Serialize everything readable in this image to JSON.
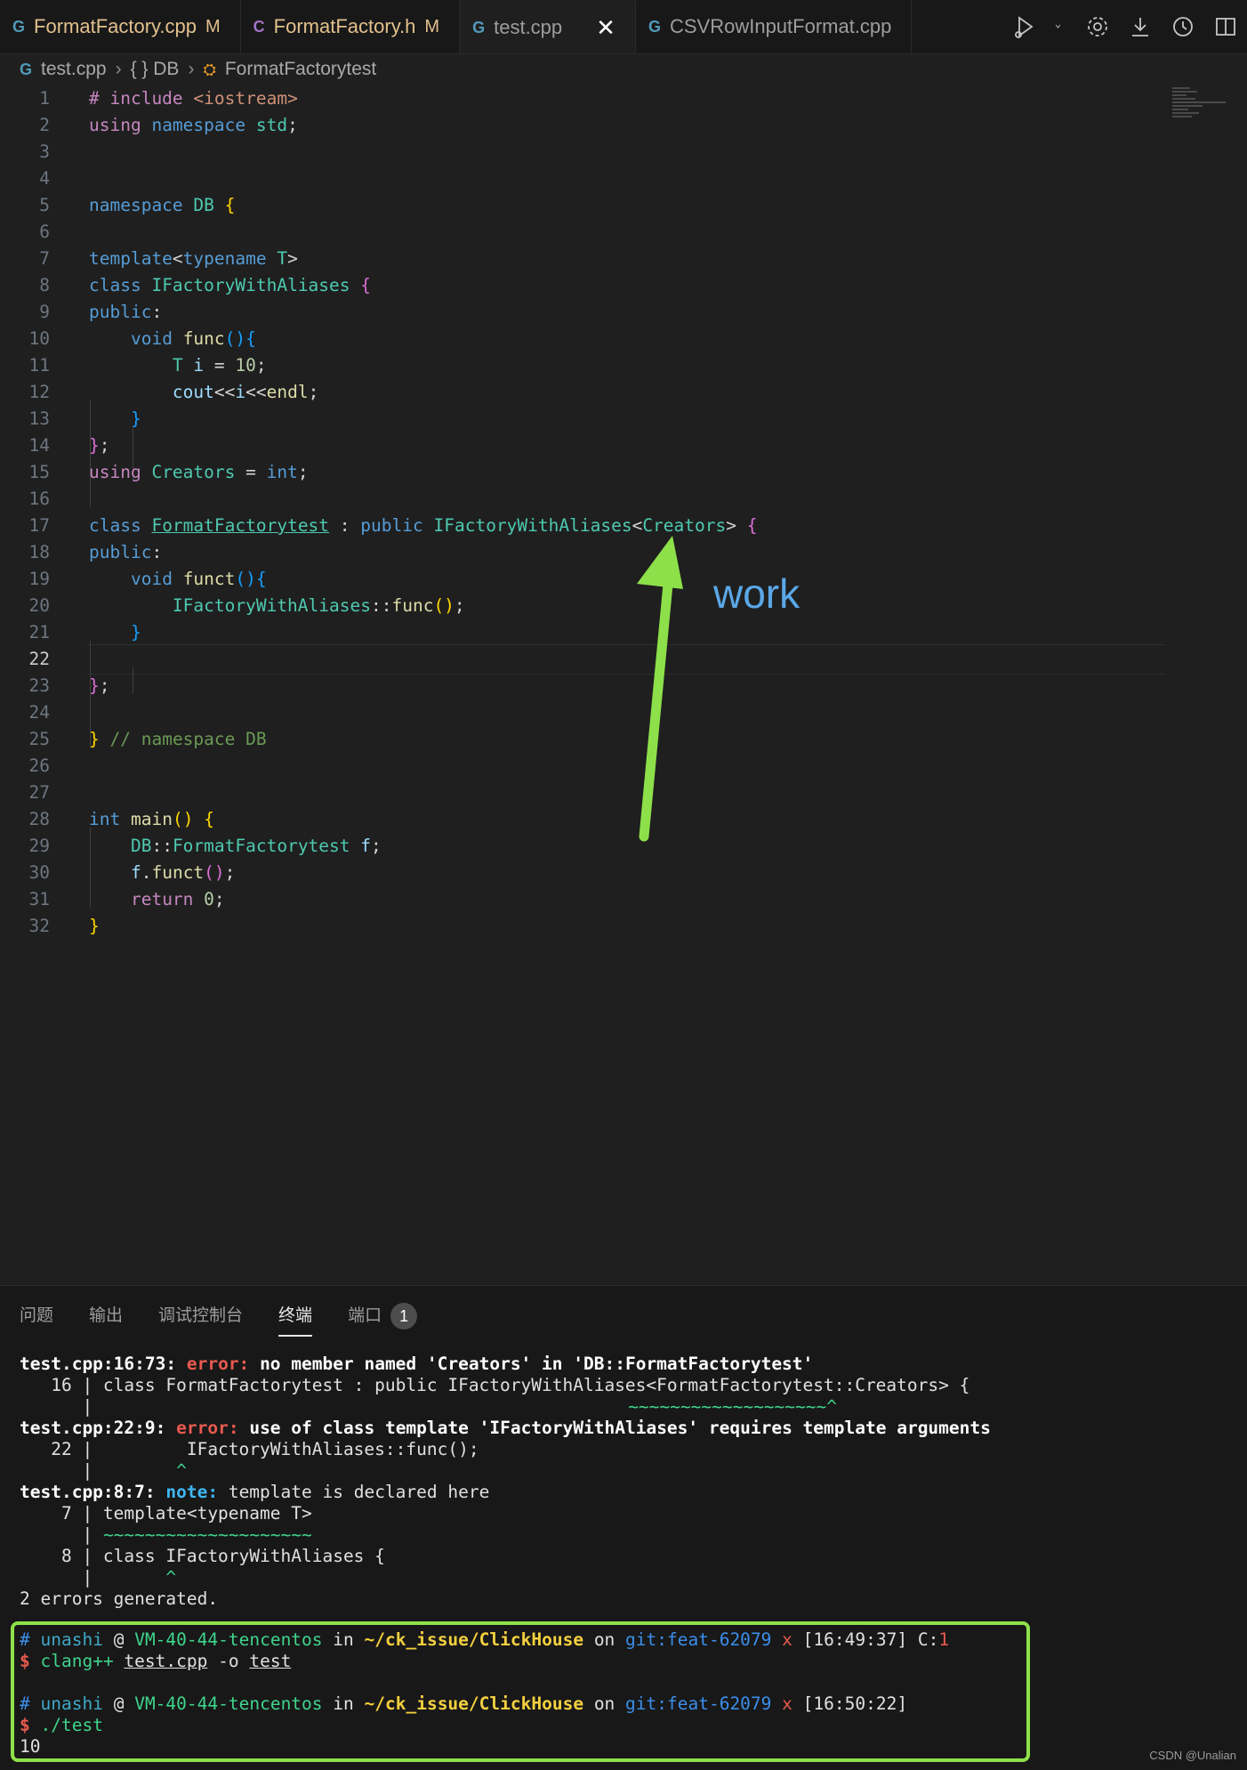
{
  "tabs": [
    {
      "icon": "cpp",
      "label": "FormatFactory.cpp",
      "modified": "M"
    },
    {
      "icon": "h",
      "label": "FormatFactory.h",
      "modified": "M"
    },
    {
      "icon": "cpp",
      "label": "test.cpp",
      "close": "✕"
    },
    {
      "icon": "cpp",
      "label": "CSVRowInputFormat.cpp"
    }
  ],
  "icon_glyphs": {
    "cpp": "G",
    "h": "C"
  },
  "breadcrumb": {
    "file": "test.cpp",
    "namespace": "{ } DB",
    "class": "FormatFactorytest"
  },
  "editor": {
    "current_line": 22
  },
  "annotation": {
    "label": "work",
    "arrow_color": "#8ee04a"
  },
  "panel": {
    "tabs": [
      "问题",
      "输出",
      "调试控制台",
      "终端",
      "端口"
    ],
    "active_tab": "终端",
    "ports_badge": "1"
  },
  "terminal": {
    "err1_loc": "test.cpp:16:73:",
    "err1_kind": "error:",
    "err1_msg": "no member named 'Creators' in 'DB::FormatFactorytest'",
    "err1_code": "   16 | class FormatFactorytest : public IFactoryWithAliases<FormatFactorytest::Creators> {",
    "err1_bar": "      |",
    "err1_marker": "~~~~~~~~~~~~~~~~~~~^",
    "err2_loc": "test.cpp:22:9:",
    "err2_kind": "error:",
    "err2_msg": "use of class template 'IFactoryWithAliases' requires template arguments",
    "err2_code": "   22 |         IFactoryWithAliases::func();",
    "err2_bar": "      |",
    "err2_marker": "        ^",
    "note_loc": "test.cpp:8:7:",
    "note_kind": "note:",
    "note_msg": "template is declared here",
    "note_code1": "    7 | template<typename T>",
    "note_bar1": "      |",
    "note_marker1": "~~~~~~~~~~~~~~~~~~~~",
    "note_code2": "    8 | class IFactoryWithAliases {",
    "note_bar2": "      |",
    "note_marker2": "      ^",
    "summary": "2 errors generated.",
    "prompt1": {
      "hash": "#",
      "user": "unashi",
      "at": "@",
      "host": "VM-40-44-tencentos",
      "in": "in",
      "path": "~/ck_issue/ClickHouse",
      "on": "on",
      "git": "git:feat-62079",
      "dirty": "x",
      "time": "[16:49:37]",
      "exit_label": "C:",
      "exit_code": "1"
    },
    "cmd1": {
      "dollar": "$",
      "bin": "clang++",
      "arg1": "test.cpp",
      "flag": "-o",
      "arg2": "test"
    },
    "prompt2": {
      "hash": "#",
      "user": "unashi",
      "at": "@",
      "host": "VM-40-44-tencentos",
      "in": "in",
      "path": "~/ck_issue/ClickHouse",
      "on": "on",
      "git": "git:feat-62079",
      "dirty": "x",
      "time": "[16:50:22]"
    },
    "cmd2": {
      "dollar": "$",
      "bin": "./test"
    },
    "output": "10"
  },
  "watermark": "CSDN @Unalian"
}
